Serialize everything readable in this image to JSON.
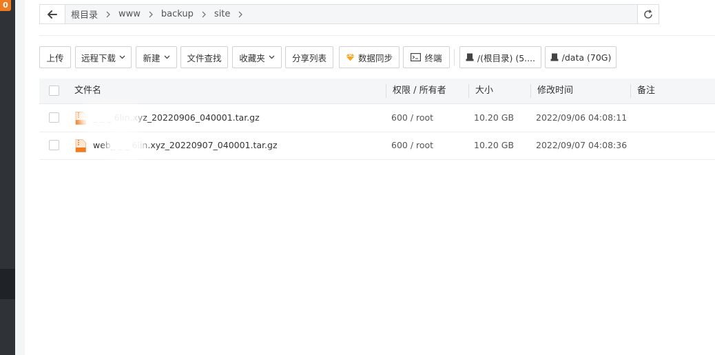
{
  "sidebar": {
    "badge": "0"
  },
  "path": {
    "crumbs": [
      "根目录",
      "www",
      "backup",
      "site"
    ]
  },
  "toolbar": {
    "upload": "上传",
    "remote_download": "远程下载",
    "new": "新建",
    "file_search": "文件查找",
    "favorites": "收藏夹",
    "share_list": "分享列表",
    "data_sync": "数据同步",
    "terminal": "终端",
    "disk_root": "/(根目录) (5....",
    "disk_data": "/data (70G)"
  },
  "table": {
    "headers": {
      "name": "文件名",
      "perm": "权限 / 所有者",
      "size": "大小",
      "mtime": "修改时间",
      "note": "备注"
    },
    "rows": [
      {
        "name": "_ _ _ 6lin.xyz_20220906_040001.tar.gz",
        "perm": "600 / root",
        "size": "10.20 GB",
        "mtime": "2022/09/06 04:08:11",
        "note": ""
      },
      {
        "name": "web_ _ _ 6lin.xyz_20220907_040001.tar.gz",
        "perm": "600 / root",
        "size": "10.20 GB",
        "mtime": "2022/09/07 04:08:36",
        "note": ""
      }
    ]
  },
  "colors": {
    "sidebar": "#2f3338",
    "badge": "#f07c1f",
    "file_icon": "#f07c1f",
    "data_sync_icon": "#f5a623"
  },
  "icons": {
    "back": "arrow-left-icon",
    "refresh": "refresh-icon",
    "data_sync": "diamond-icon",
    "terminal": "terminal-icon",
    "disk": "disk-icon",
    "file": "archive-file-icon"
  }
}
